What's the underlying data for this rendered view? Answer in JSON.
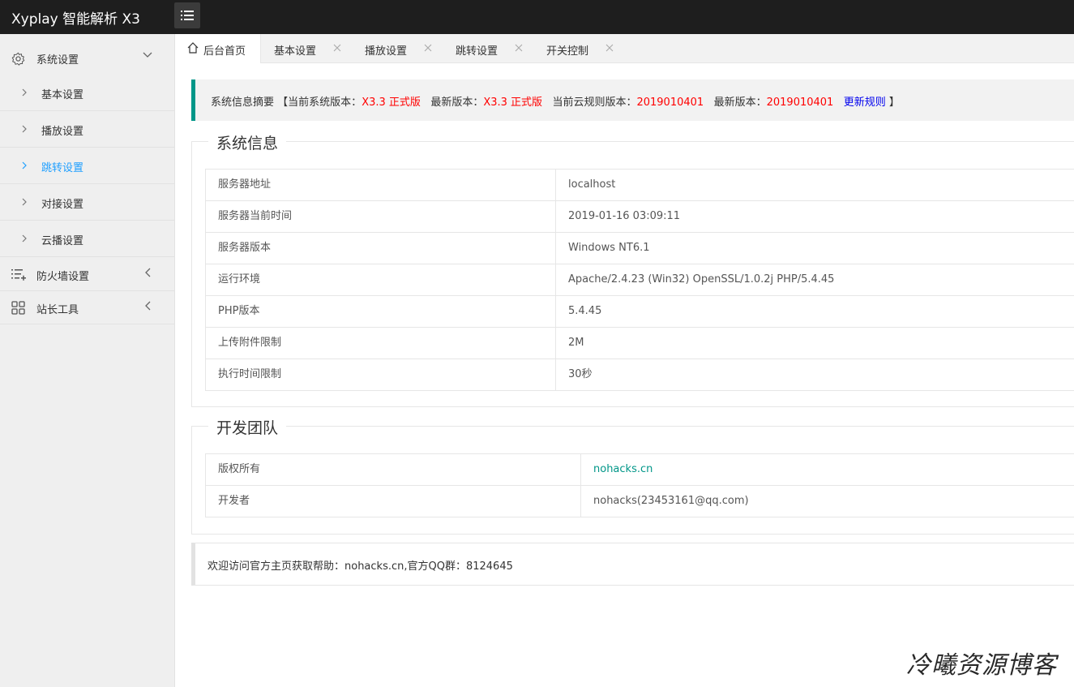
{
  "header": {
    "title": "Xyplay 智能解析 X3"
  },
  "sidebar": {
    "groups": [
      {
        "label": "系统设置",
        "icon": "gear-icon",
        "expanded": true
      },
      {
        "label": "防火墙设置",
        "icon": "list-add-icon"
      },
      {
        "label": "站长工具",
        "icon": "grid-icon"
      }
    ],
    "items": [
      {
        "label": "基本设置"
      },
      {
        "label": "播放设置"
      },
      {
        "label": "跳转设置",
        "active": true
      },
      {
        "label": "对接设置"
      },
      {
        "label": "云播设置"
      }
    ]
  },
  "tabs": [
    {
      "label": "后台首页",
      "active": true
    },
    {
      "label": "基本设置"
    },
    {
      "label": "播放设置"
    },
    {
      "label": "跳转设置"
    },
    {
      "label": "开关控制"
    }
  ],
  "summary": {
    "prefix": "系统信息摘要",
    "open": "【",
    "cur_label": "当前系统版本：",
    "cur_value": "X3.3 正式版",
    "latest_label": "最新版本：",
    "latest_value": "X3.3 正式版",
    "rule_label": "当前云规则版本：",
    "rule_value": "2019010401",
    "latest_rule_label": "最新版本：",
    "latest_rule_value": "2019010401",
    "update_link": "更新规则",
    "close": "】"
  },
  "sysinfo": {
    "title": "系统信息",
    "rows": [
      {
        "key": "服务器地址",
        "value": "localhost"
      },
      {
        "key": "服务器当前时间",
        "value": "2019-01-16 03:09:11"
      },
      {
        "key": "服务器版本",
        "value": "Windows NT6.1"
      },
      {
        "key": "运行环境",
        "value": "Apache/2.4.23 (Win32) OpenSSL/1.0.2j PHP/5.4.45"
      },
      {
        "key": "PHP版本",
        "value": "5.4.45"
      },
      {
        "key": "上传附件限制",
        "value": "2M"
      },
      {
        "key": "执行时间限制",
        "value": "30秒"
      }
    ]
  },
  "team": {
    "title": "开发团队",
    "rows": [
      {
        "key": "版权所有",
        "value": "nohacks.cn"
      },
      {
        "key": "开发者",
        "value": "nohacks(23453161@qq.com)"
      }
    ]
  },
  "notice": {
    "text": "欢迎访问官方主页获取帮助：nohacks.cn,官方QQ群：8124645"
  },
  "watermark": {
    "text": "冷曦资源博客"
  },
  "colors": {
    "accent": "#009688",
    "active_link": "#1e9fff",
    "highlight": "#ff0000",
    "link_blue": "#0000ee",
    "header_bg": "#1e1e1e"
  }
}
